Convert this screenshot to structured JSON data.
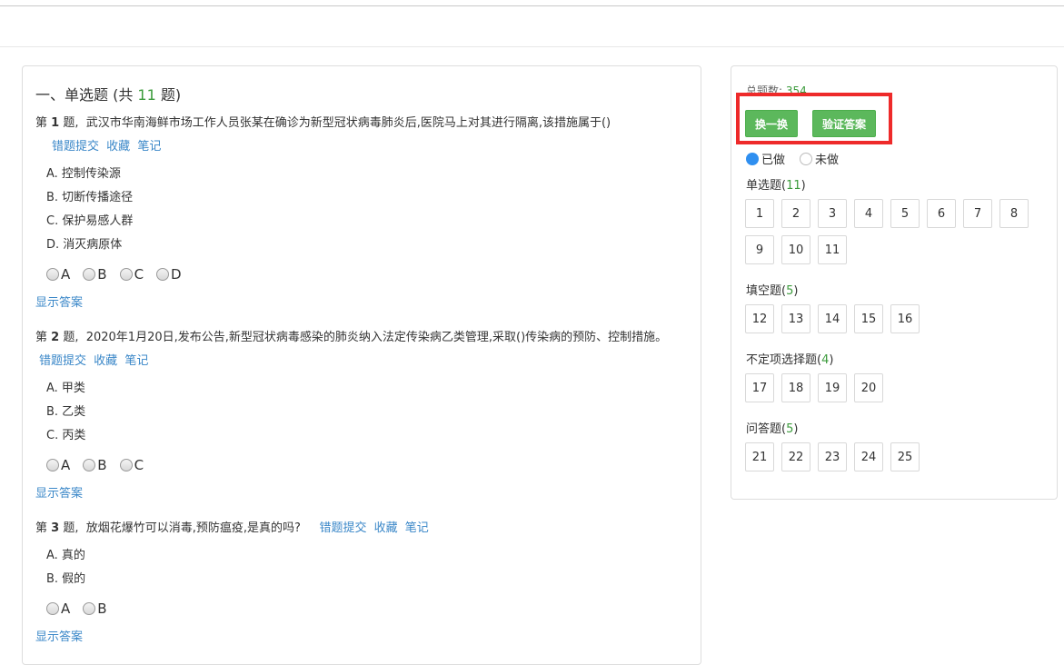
{
  "section": {
    "prefix": "一、单选题 (共 ",
    "count": "11",
    "suffix": " 题)"
  },
  "link_labels": {
    "report": "错题提交",
    "fav": "收藏",
    "note": "笔记",
    "show_answer": "显示答案"
  },
  "questions": [
    {
      "num_prefix": "第 ",
      "num": "1",
      "num_suffix": " 题,",
      "text": "武汉市华南海鲜市场工作人员张某在确诊为新型冠状病毒肺炎后,医院马上对其进行隔离,该措施属于()",
      "options": [
        "A. 控制传染源",
        "B. 切断传播途径",
        "C. 保护易感人群",
        "D. 消灭病原体"
      ],
      "choices": [
        "A",
        "B",
        "C",
        "D"
      ]
    },
    {
      "num_prefix": "第 ",
      "num": "2",
      "num_suffix": " 题,",
      "text": "2020年1月20日,发布公告,新型冠状病毒感染的肺炎纳入法定传染病乙类管理,采取()传染病的预防、控制措施。",
      "options": [
        "A. 甲类",
        "B. 乙类",
        "C. 丙类"
      ],
      "choices": [
        "A",
        "B",
        "C"
      ]
    },
    {
      "num_prefix": "第 ",
      "num": "3",
      "num_suffix": " 题,",
      "text": "放烟花爆竹可以消毒,预防瘟疫,是真的吗?",
      "options": [
        "A. 真的",
        "B. 假的"
      ],
      "choices": [
        "A",
        "B"
      ]
    }
  ],
  "sidebar": {
    "total_label": "总题数:",
    "total_value": "354",
    "shuffle_button": "换一换",
    "verify_button": "验证答案",
    "legend_done": "已做",
    "legend_undone": "未做",
    "colors": {
      "green": "#5cb85c",
      "blue_dot": "#2f8ff0",
      "highlight": "#ee2a2a"
    },
    "categories": [
      {
        "name": "单选题(",
        "count": "11",
        "close": ")",
        "items": [
          "1",
          "2",
          "3",
          "4",
          "5",
          "6",
          "7",
          "8",
          "9",
          "10",
          "11"
        ]
      },
      {
        "name": "填空题(",
        "count": "5",
        "close": ")",
        "items": [
          "12",
          "13",
          "14",
          "15",
          "16"
        ]
      },
      {
        "name": "不定项选择题(",
        "count": "4",
        "close": ")",
        "items": [
          "17",
          "18",
          "19",
          "20"
        ]
      },
      {
        "name": "问答题(",
        "count": "5",
        "close": ")",
        "items": [
          "21",
          "22",
          "23",
          "24",
          "25"
        ]
      }
    ]
  }
}
